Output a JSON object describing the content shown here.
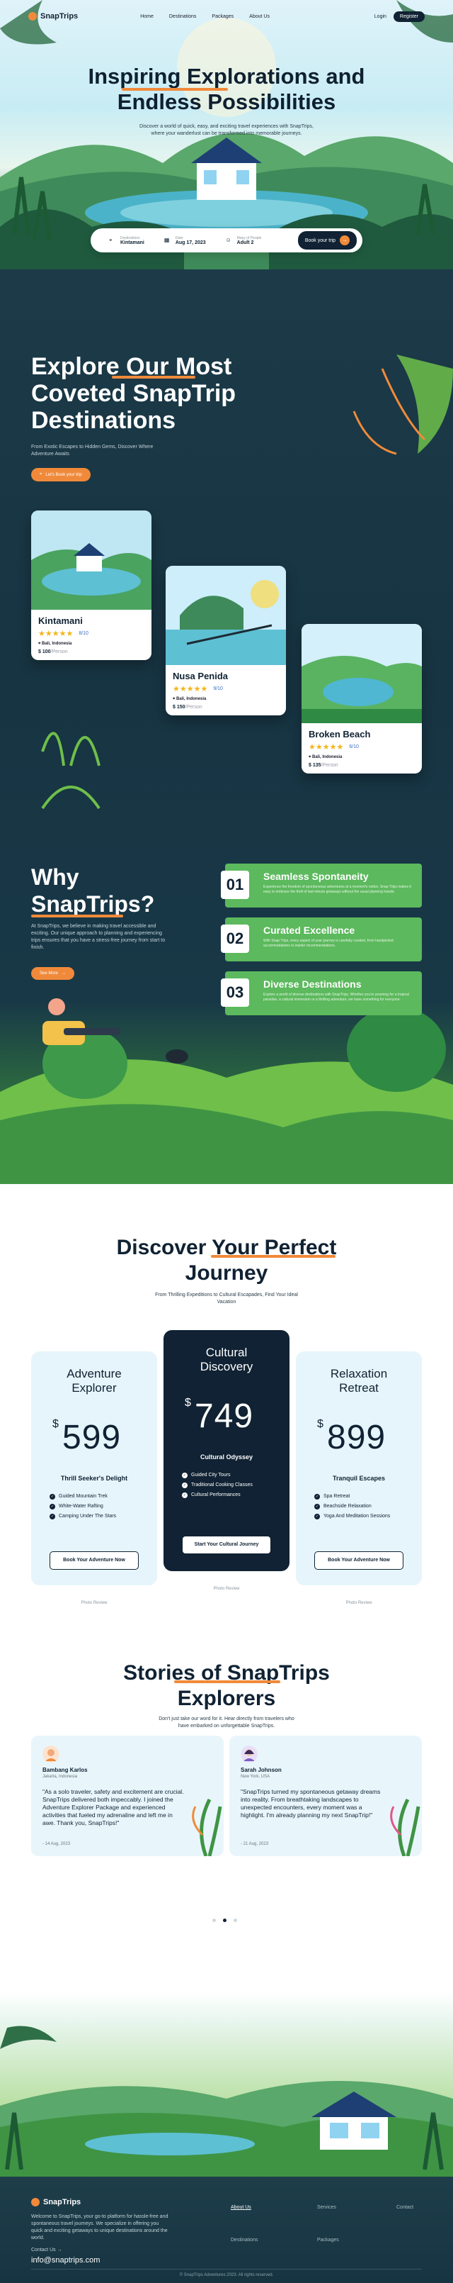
{
  "nav": {
    "logo": "SnapTrips",
    "links": [
      "Home",
      "Destinations",
      "Packages",
      "About Us"
    ],
    "login": "Login",
    "register": "Register"
  },
  "hero": {
    "title_line1": "Inspiring Explorations and",
    "title_line2": "Endless Possibilities",
    "subtitle": "Discover a world of quick, easy, and exciting travel experiences with SnapTrips, where your wanderlust can be transformed into memorable journeys.",
    "search": {
      "location_label": "Destinations",
      "location_value": "Kintamani",
      "date_label": "Date",
      "date_value": "Aug 17, 2023",
      "people_label": "Many of People",
      "people_value": "Adult 2",
      "button": "Book your trip"
    }
  },
  "explore": {
    "title_line1": "Explore Our Most",
    "title_line2": "Coveted SnapTrip",
    "title_line3": "Destinations",
    "subtitle": "From Exotic Escapes to Hidden Gems, Discover Where Adventure Awaits",
    "button": "Let's Book your trip",
    "cards": [
      {
        "name": "Kintamani",
        "rating": "8/10",
        "location": "Bali, Indonesia",
        "price": "$ 100",
        "per": "/Person"
      },
      {
        "name": "Nusa Penida",
        "rating": "9/10",
        "location": "Bali, Indonesia",
        "price": "$ 150",
        "per": "/Person"
      },
      {
        "name": "Broken Beach",
        "rating": "6/10",
        "location": "Bali, Indonesia",
        "price": "$ 135",
        "per": "/Person"
      }
    ]
  },
  "why": {
    "title_line1": "Why",
    "title_line2": "SnapTrips?",
    "body": "At SnapTrips, we believe in making travel accessible and exciting. Our unique approach to planning and experiencing trips ensures that you have a stress-free journey from start to finish.",
    "button": "See More",
    "items": [
      {
        "num": "01",
        "title": "Seamless Spontaneity",
        "desc": "Experience the freedom of spontaneous adventures at a moment's notice. Snap Trips makes it easy to embrace the thrill of last-minute getaways without the usual planning hassle."
      },
      {
        "num": "02",
        "title": "Curated Excellence",
        "desc": "With Snap Trips, every aspect of your journey is carefully curated, from handpicked accommodations to insider recommendations."
      },
      {
        "num": "03",
        "title": "Diverse Destinations",
        "desc": "Explore a world of diverse destinations with SnapTrips. Whether you're yearning for a tropical paradise, a cultural immersion or a thrilling adventure, we have something for everyone."
      }
    ]
  },
  "pricing": {
    "title_line1": "Discover Your Perfect",
    "title_line2": "Journey",
    "subtitle": "From Thrilling Expeditions to Cultural Escapades, Find Your Ideal Vacation",
    "plans": [
      {
        "title_line1": "Adventure",
        "title_line2": "Explorer",
        "currency": "$",
        "price": "599",
        "tag": "Thrill Seeker's Delight",
        "features": [
          "Guided Mountain Trek",
          "White-Water Rafting",
          "Camping Under The Stars"
        ],
        "button": "Book Your Adventure Now",
        "foot": "Photo Review"
      },
      {
        "title_line1": "Cultural",
        "title_line2": "Discovery",
        "currency": "$",
        "price": "749",
        "tag": "Cultural Odyssey",
        "features": [
          "Guided City Tours",
          "Traditional Cooking Classes",
          "Cultural Performances"
        ],
        "button": "Start Your Cultural Journey",
        "foot": "Photo Review"
      },
      {
        "title_line1": "Relaxation",
        "title_line2": "Retreat",
        "currency": "$",
        "price": "899",
        "tag": "Tranquil Escapes",
        "features": [
          "Spa Retreat",
          "Beachside Relaxation",
          "Yoga And Meditation Sessions"
        ],
        "button": "Book Your Adventure Now",
        "foot": "Photo Review"
      }
    ]
  },
  "stories": {
    "title_line1": "Stories of SnapTrips",
    "title_line2": "Explorers",
    "subtitle": "Don't just take our word for it. Hear directly from travelers who have embarked on unforgettable SnapTrips.",
    "items": [
      {
        "name": "Bambang Karlos",
        "location": "Jakarta, Indonesia",
        "quote": "\"As a solo traveler, safety and excitement are crucial. SnapTrips delivered both impeccably. I joined the Adventure Explorer Package and experienced activities that fueled my adrenaline and left me in awe. Thank you, SnapTrips!\"",
        "date": "- 14 Aug, 2023"
      },
      {
        "name": "Sarah Johnson",
        "location": "New York, USA",
        "quote": "\"SnapTrips turned my spontaneous getaway dreams into reality. From breathtaking landscapes to unexpected encounters, every moment was a highlight. I'm already planning my next SnapTrip!\"",
        "date": "- 21 Aug, 2023"
      }
    ]
  },
  "footer": {
    "logo": "SnapTrips",
    "body": "Welcome to SnapTrips, your go-to platform for hassle-free and spontaneous travel journeys. We specialize in offering you quick and exciting getaways to unique destinations around the world.",
    "contact_label": "Contact Us",
    "email": "info@snaptrips.com",
    "links": [
      "About Us",
      "Services",
      "Contact",
      "Destinations",
      "Packages"
    ],
    "copyright": "© SnapTrips Adventures 2023. All rights reserved."
  }
}
